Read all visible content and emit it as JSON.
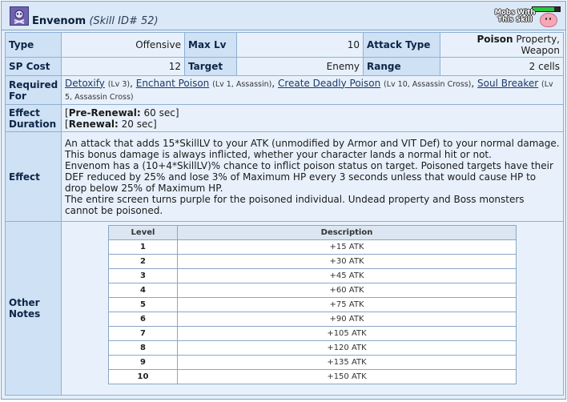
{
  "header": {
    "skill_name": "Envenom",
    "skill_id_text": "(Skill ID# 52)",
    "mobs_badge_text": "Mobs With This Skill",
    "mobs_bar_fill_fraction": 0.8
  },
  "rows": {
    "type_label": "Type",
    "type_value": "Offensive",
    "max_lv_label": "Max Lv",
    "max_lv_value": "10",
    "attack_type_label": "Attack Type",
    "attack_type_bold": "Poison",
    "attack_type_rest": " Property, Weapon",
    "sp_cost_label": "SP Cost",
    "sp_cost_value": "12",
    "target_label": "Target",
    "target_value": "Enemy",
    "range_label": "Range",
    "range_value": "2 cells",
    "required_for_label": "Required For",
    "required_for": [
      {
        "name": "Detoxify",
        "detail": "(Lv 3)",
        "sep": ", "
      },
      {
        "name": "Enchant Poison",
        "detail": "(Lv 1, Assassin)",
        "sep": ", "
      },
      {
        "name": "Create Deadly Poison",
        "detail": "(Lv 10, Assassin Cross)",
        "sep": ", "
      },
      {
        "name": "Soul Breaker",
        "detail": "(Lv 5, Assassin Cross)",
        "sep": ""
      }
    ],
    "effect_duration_label": "Effect Duration",
    "pre_renewal_label": "Pre-Renewal:",
    "pre_renewal_value": " 60 sec",
    "renewal_label": "Renewal:",
    "renewal_value": " 20 sec",
    "effect_label": "Effect",
    "effect_paragraphs": [
      "An attack that adds 15*SkillLV to your ATK (unmodified by Armor and VIT Def) to your normal damage. This bonus damage is always inflicted, whether your character lands a normal hit or not.",
      "Envenom has a (10+4*SkillLV)% chance to inflict poison status on target. Poisoned targets have their DEF reduced by 25% and lose 3% of Maximum HP every 3 seconds unless that would cause HP to drop below 25% of Maximum HP.",
      "The entire screen turns purple for the poisoned individual. Undead property and Boss monsters cannot be poisoned."
    ],
    "other_notes_label": "Other Notes"
  },
  "levels_table": {
    "headers": [
      "Level",
      "Description"
    ],
    "rows": [
      {
        "level": "1",
        "desc": "+15 ATK"
      },
      {
        "level": "2",
        "desc": "+30 ATK"
      },
      {
        "level": "3",
        "desc": "+45 ATK"
      },
      {
        "level": "4",
        "desc": "+60 ATK"
      },
      {
        "level": "5",
        "desc": "+75 ATK"
      },
      {
        "level": "6",
        "desc": "+90 ATK"
      },
      {
        "level": "7",
        "desc": "+105 ATK"
      },
      {
        "level": "8",
        "desc": "+120 ATK"
      },
      {
        "level": "9",
        "desc": "+135 ATK"
      },
      {
        "level": "10",
        "desc": "+150 ATK"
      }
    ]
  },
  "icons": {
    "skill": "envenom-skill-icon",
    "mobs": "poring-icon"
  },
  "colors": {
    "frame_border": "#7fa4c8",
    "label_bg": "#cfe1f5",
    "value_bg": "#e8f1fb",
    "link": "#1a3a6b"
  }
}
